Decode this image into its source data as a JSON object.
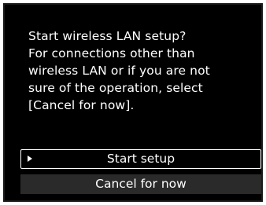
{
  "dialog": {
    "message_lines": [
      "Start wireless LAN setup?",
      "For connections other than",
      "wireless LAN or if you are not",
      "sure of the operation, select",
      "[Cancel for now]."
    ],
    "options": [
      {
        "label": "Start setup",
        "selected": true
      },
      {
        "label": "Cancel for now",
        "selected": false
      }
    ]
  },
  "colors": {
    "background": "#000000",
    "text": "#ffffff",
    "option_bar": "#2a2a2a"
  },
  "icons": {
    "selection_cursor": "triangle-right-icon"
  }
}
